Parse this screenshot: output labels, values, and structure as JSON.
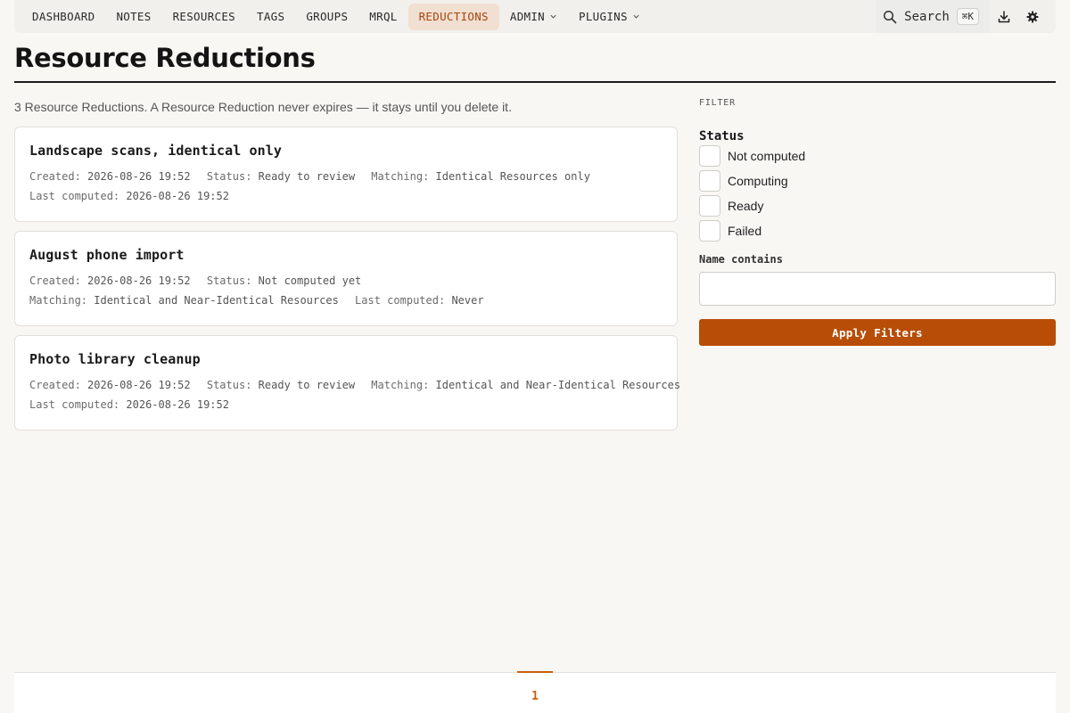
{
  "nav": {
    "items": [
      {
        "label": "DASHBOARD"
      },
      {
        "label": "NOTES"
      },
      {
        "label": "RESOURCES"
      },
      {
        "label": "TAGS"
      },
      {
        "label": "GROUPS"
      },
      {
        "label": "MRQL"
      },
      {
        "label": "REDUCTIONS",
        "active": true
      },
      {
        "label": "ADMIN",
        "dropdown": true
      },
      {
        "label": "PLUGINS",
        "dropdown": true
      }
    ],
    "search_label": "Search",
    "search_shortcut": "⌘K"
  },
  "page": {
    "title": "Resource Reductions",
    "summary": "3 Resource Reductions. A Resource Reduction never expires — it stays until you delete it."
  },
  "reductions": [
    {
      "name": "Landscape scans, identical only",
      "created_label": "Created:",
      "created": "2026-08-26 19:52",
      "status_label": "Status:",
      "status": "Ready to review",
      "matching_label": "Matching:",
      "matching": "Identical Resources only",
      "last_label": "Last computed:",
      "last": "2026-08-26 19:52"
    },
    {
      "name": "August phone import",
      "created_label": "Created:",
      "created": "2026-08-26 19:52",
      "status_label": "Status:",
      "status": "Not computed yet",
      "matching_label": "Matching:",
      "matching": "Identical and Near-Identical Resources",
      "last_label": "Last computed:",
      "last": "Never"
    },
    {
      "name": "Photo library cleanup",
      "created_label": "Created:",
      "created": "2026-08-26 19:52",
      "status_label": "Status:",
      "status": "Ready to review",
      "matching_label": "Matching:",
      "matching": "Identical and Near-Identical Resources",
      "last_label": "Last computed:",
      "last": "2026-08-26 19:52"
    }
  ],
  "filter": {
    "heading": "FILTER",
    "status_label": "Status",
    "status_options": [
      "Not computed",
      "Computing",
      "Ready",
      "Failed"
    ],
    "name_label": "Name contains",
    "name_value": "",
    "apply_label": "Apply Filters"
  },
  "pagination": {
    "current": "1"
  },
  "colors": {
    "accent": "#b84d07",
    "active_nav_bg": "#f1dfd2",
    "active_nav_text": "#a8450c",
    "background": "#f8f7f4"
  }
}
